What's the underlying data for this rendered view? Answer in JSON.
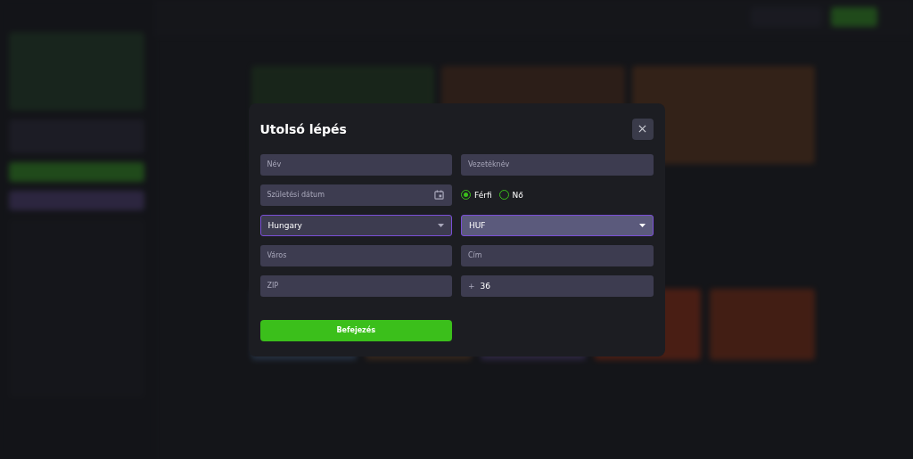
{
  "modal": {
    "title": "Utolsó lépés",
    "rows": [
      [
        {
          "kind": "text",
          "placeholder": "Név"
        },
        {
          "kind": "text",
          "placeholder": "Vezetéknév"
        }
      ],
      [
        {
          "kind": "date",
          "placeholder": "Születési dátum"
        },
        {
          "kind": "radio",
          "options": [
            {
              "label": "Férfi",
              "selected": true
            },
            {
              "label": "Nő",
              "selected": false
            }
          ]
        }
      ],
      [
        {
          "kind": "select",
          "value": "Hungary",
          "highlighted": false
        },
        {
          "kind": "select",
          "value": "HUF",
          "highlighted": true
        }
      ],
      [
        {
          "kind": "text",
          "placeholder": "Város"
        },
        {
          "kind": "text",
          "placeholder": "Cím"
        }
      ],
      [
        {
          "kind": "text",
          "placeholder": "ZIP"
        },
        {
          "kind": "phone",
          "prefix": "+",
          "value": "36"
        }
      ]
    ],
    "submit": "Befejezés"
  }
}
